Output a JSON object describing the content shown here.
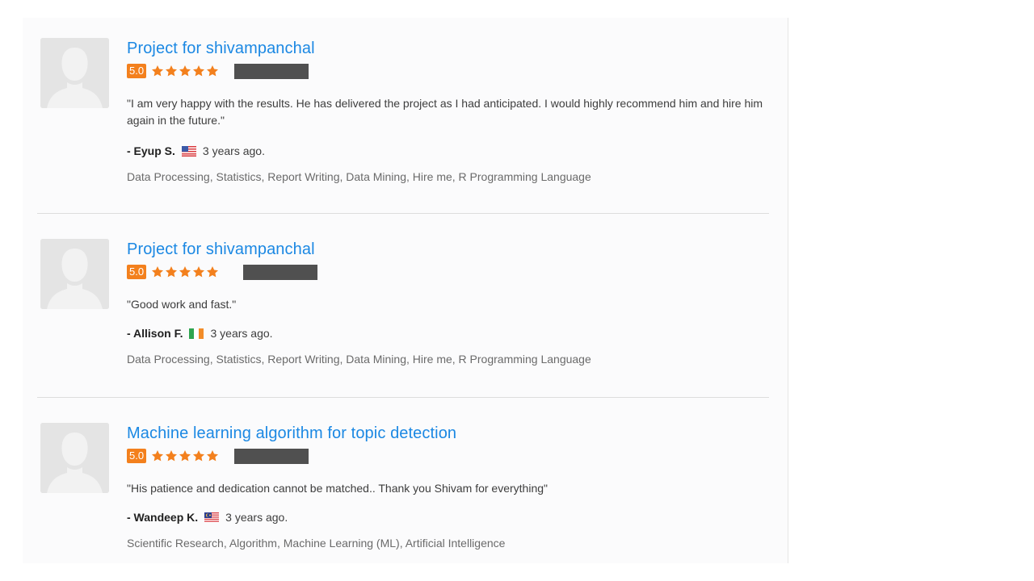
{
  "reviews": [
    {
      "title": "Project for shivampanchal",
      "score": "5.0",
      "stars": 5,
      "quote": "\"I am very happy with the results. He has delivered the project as I had anticipated. I would highly recommend him and hire him again in the future.\"",
      "reviewer": "- Eyup S.",
      "flag_icon": "us-flag-icon",
      "time": "3 years ago.",
      "skills": "Data Processing, Statistics, Report Writing, Data Mining, Hire me, R Programming Language"
    },
    {
      "title": "Project for shivampanchal",
      "score": "5.0",
      "stars": 5,
      "quote": "\"Good work and fast.\"",
      "reviewer": "- Allison F.",
      "flag_icon": "ireland-flag-icon",
      "time": "3 years ago.",
      "skills": "Data Processing, Statistics, Report Writing, Data Mining, Hire me, R Programming Language"
    },
    {
      "title": "Machine learning algorithm for topic detection",
      "score": "5.0",
      "stars": 5,
      "quote": "\"His patience and dedication cannot be matched.. Thank you Shivam for everything\"",
      "reviewer": "- Wandeep K.",
      "flag_icon": "malaysia-flag-icon",
      "time": "3 years ago.",
      "skills": "Scientific Research, Algorithm, Machine Learning (ML), Artificial Intelligence"
    }
  ],
  "colors": {
    "title_link": "#1b88e3",
    "rating_badge": "#f3801d",
    "star": "#f3801d",
    "redaction": "#505050"
  },
  "icons": {
    "avatar": "default-user-silhouette-icon",
    "star": "star-icon"
  }
}
